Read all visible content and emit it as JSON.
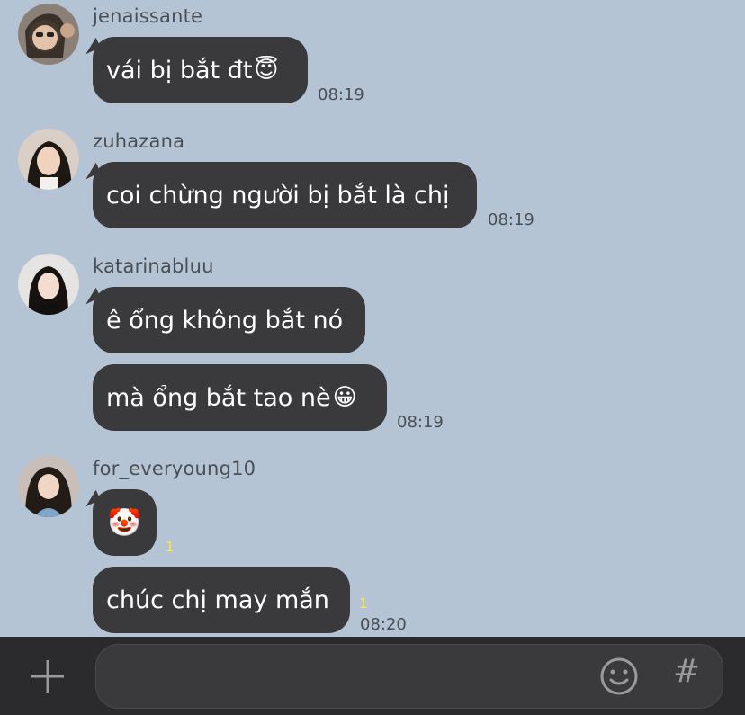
{
  "messages": [
    {
      "sender": "jenaissante",
      "avatar": "avatar-jenaissante",
      "text": "vái bị bắt đt",
      "emoji": "😇",
      "time": "08:19"
    },
    {
      "sender": "zuhazana",
      "avatar": "avatar-zuhazana",
      "text": "coi chừng người bị bắt là chị",
      "time": "08:19"
    },
    {
      "sender": "katarinabluu",
      "avatar": "avatar-katarinabluu",
      "text1": "ê ổng không bắt nó",
      "text2": "mà ổng bắt tao nè",
      "emoji2": "😀",
      "time": "08:19"
    },
    {
      "sender": "for_everyoung10",
      "avatar": "avatar-for-everyoung10",
      "emoji": "🤡",
      "unread1": "1",
      "text2": "chúc chị may mắn",
      "unread2": "1",
      "time": "08:20"
    }
  ],
  "input": {
    "placeholder": "",
    "plus_icon": "plus-icon",
    "emoji_icon": "smiley-icon",
    "hash_label": "#"
  },
  "colors": {
    "background": "#b5c4d4",
    "bubble": "#3a3a3c",
    "bubble_text": "#ffffff",
    "unread": "#ffe93b",
    "input_bar": "#2b2b2d"
  }
}
